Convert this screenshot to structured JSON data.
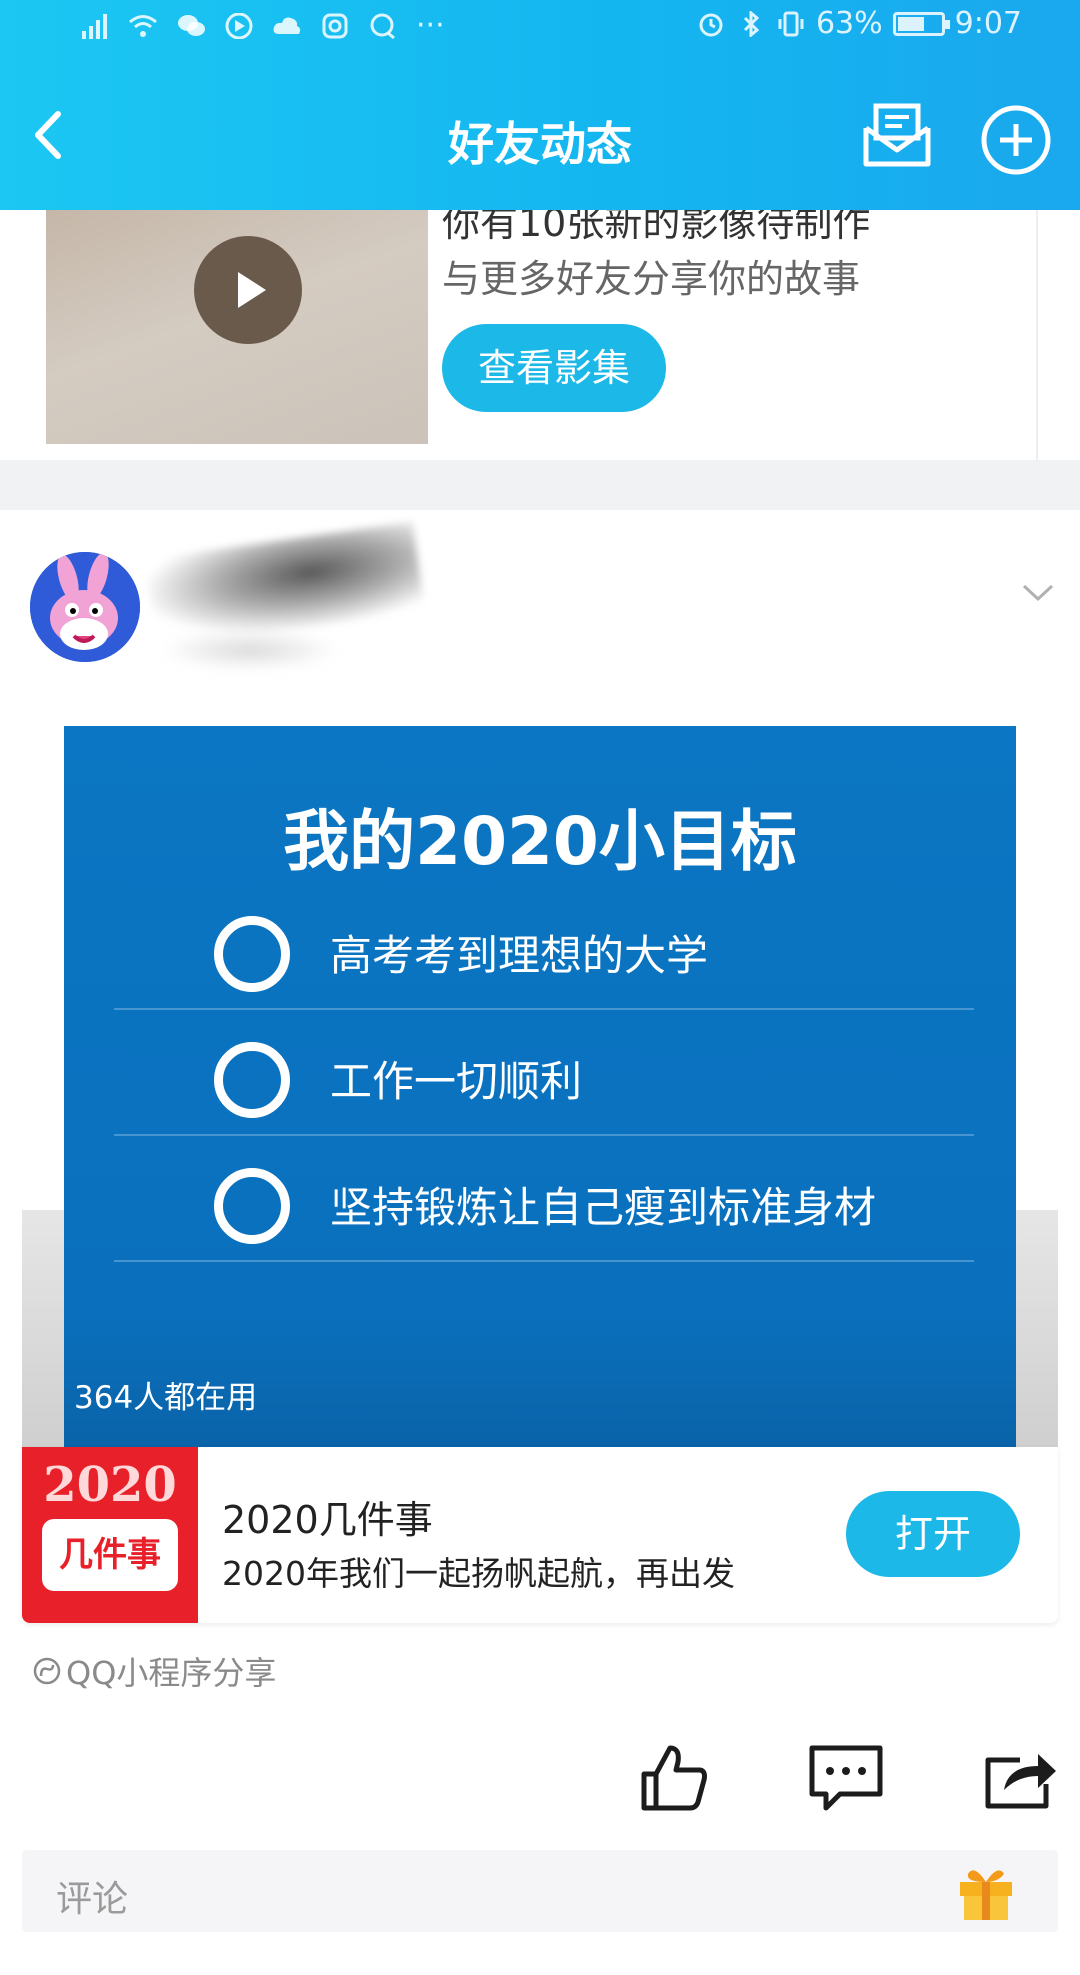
{
  "status_bar": {
    "battery_text": "63%",
    "battery_level": 0.63,
    "time": "9:07",
    "more_dots": "···"
  },
  "nav": {
    "title": "好友动态"
  },
  "album": {
    "line1": "你有10张新的影像待制作",
    "line2": "与更多好友分享你的故事",
    "button": "查看影集"
  },
  "post": {
    "goal_card": {
      "title": "我的2020小目标",
      "items": [
        "高考考到理想的大学",
        "工作一切顺利",
        "坚持锻炼让自己瘦到标准身材"
      ],
      "users": "364人都在用"
    },
    "mini_program": {
      "logo_year": "2020",
      "logo_text": "几件事",
      "name": "2020几件事",
      "desc": "2020年我们一起扬帆起航，再出发",
      "open_button": "打开"
    },
    "source": "QQ小程序分享",
    "comment_placeholder": "评论"
  },
  "colors": {
    "header": "#14b5f0",
    "accent_button": "#1cb8e8",
    "goal_bg": "#0b76c3",
    "logo_red": "#e8202a"
  },
  "icons": [
    "signal-icon",
    "wifi-icon",
    "wechat-icon",
    "play-store-icon",
    "cloud-icon",
    "instagram-icon",
    "chat-icon",
    "alarm-icon",
    "bluetooth-icon",
    "vibrate-icon",
    "battery-icon",
    "back-icon",
    "mail-icon",
    "plus-icon",
    "play-icon",
    "chevron-down-icon",
    "mini-program-icon",
    "like-icon",
    "comment-icon",
    "share-icon",
    "gift-icon"
  ]
}
